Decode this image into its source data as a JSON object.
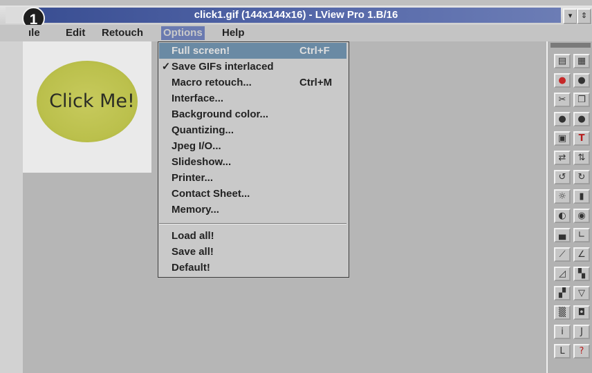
{
  "window": {
    "title": "click1.gif (144x144x16) - LView Pro 1.B/16",
    "step_number": "1",
    "minimize_glyph": "▾",
    "restore_glyph": "⇕"
  },
  "menubar": {
    "items": [
      {
        "label": "File",
        "visible": "ıle"
      },
      {
        "label": "Edit"
      },
      {
        "label": "Retouch"
      },
      {
        "label": "Options"
      },
      {
        "label": "Help"
      }
    ]
  },
  "image": {
    "text": "Click Me!",
    "oval_color": "#bfc34f"
  },
  "options_menu": {
    "items": [
      {
        "label": "Full screen!",
        "shortcut": "Ctrl+F",
        "checked": "",
        "selected": true
      },
      {
        "label": "Save GIFs interlaced",
        "shortcut": "",
        "checked": "✓",
        "selected": false
      },
      {
        "label": "Macro retouch...",
        "shortcut": "Ctrl+M",
        "checked": "",
        "selected": false
      },
      {
        "label": "Interface...",
        "shortcut": "",
        "checked": "",
        "selected": false
      },
      {
        "label": "Background color...",
        "shortcut": "",
        "checked": "",
        "selected": false
      },
      {
        "label": "Quantizing...",
        "shortcut": "",
        "checked": "",
        "selected": false
      },
      {
        "label": "Jpeg I/O...",
        "shortcut": "",
        "checked": "",
        "selected": false
      },
      {
        "label": "Slideshow...",
        "shortcut": "",
        "checked": "",
        "selected": false
      },
      {
        "label": "Printer...",
        "shortcut": "",
        "checked": "",
        "selected": false
      },
      {
        "label": "Contact Sheet...",
        "shortcut": "",
        "checked": "",
        "selected": false
      },
      {
        "label": "Memory...",
        "shortcut": "",
        "checked": "",
        "selected": false
      },
      {
        "label": "Load all!",
        "shortcut": "",
        "checked": "",
        "selected": false
      },
      {
        "label": "Save all!",
        "shortcut": "",
        "checked": "",
        "selected": false
      },
      {
        "label": "Default!",
        "shortcut": "",
        "checked": "",
        "selected": false
      }
    ]
  },
  "toolbox": {
    "buttons": [
      {
        "name": "open-file-icon",
        "glyph": "▤"
      },
      {
        "name": "next-file-icon",
        "glyph": "▦"
      },
      {
        "name": "red-color-icon",
        "glyph": "●"
      },
      {
        "name": "dark-circle-icon",
        "glyph": "●"
      },
      {
        "name": "scissors-icon",
        "glyph": "✂"
      },
      {
        "name": "copy-icon",
        "glyph": "❐"
      },
      {
        "name": "gray-circle-icon",
        "glyph": "●"
      },
      {
        "name": "gray-circle-2-icon",
        "glyph": "●"
      },
      {
        "name": "select-frame-icon",
        "glyph": "▣"
      },
      {
        "name": "text-tool-icon",
        "glyph": "T"
      },
      {
        "name": "swap-horizontal-icon",
        "glyph": "⇄"
      },
      {
        "name": "swap-vertical-icon",
        "glyph": "⇅"
      },
      {
        "name": "rotate-left-icon",
        "glyph": "↺"
      },
      {
        "name": "rotate-right-icon",
        "glyph": "↻"
      },
      {
        "name": "brightness-icon",
        "glyph": "☼"
      },
      {
        "name": "contrast-bars-icon",
        "glyph": "▮"
      },
      {
        "name": "contrast-icon",
        "glyph": "◐"
      },
      {
        "name": "color-balance-icon",
        "glyph": "◉"
      },
      {
        "name": "histogram-icon",
        "glyph": "▄"
      },
      {
        "name": "curve-icon",
        "glyph": "∟"
      },
      {
        "name": "gamma-icon",
        "glyph": "⟋"
      },
      {
        "name": "curve-2-icon",
        "glyph": "∠"
      },
      {
        "name": "triangle-icon",
        "glyph": "◿"
      },
      {
        "name": "palette-icon",
        "glyph": "▚"
      },
      {
        "name": "checker-icon",
        "glyph": "▞"
      },
      {
        "name": "filter-icon",
        "glyph": "▽"
      },
      {
        "name": "texture-icon",
        "glyph": "▒"
      },
      {
        "name": "frame-icon",
        "glyph": "◘"
      },
      {
        "name": "info-icon",
        "glyph": "i"
      },
      {
        "name": "jpeg-icon",
        "glyph": "J"
      },
      {
        "name": "text-2-icon",
        "glyph": "L"
      },
      {
        "name": "help-icon",
        "glyph": "?"
      }
    ]
  }
}
